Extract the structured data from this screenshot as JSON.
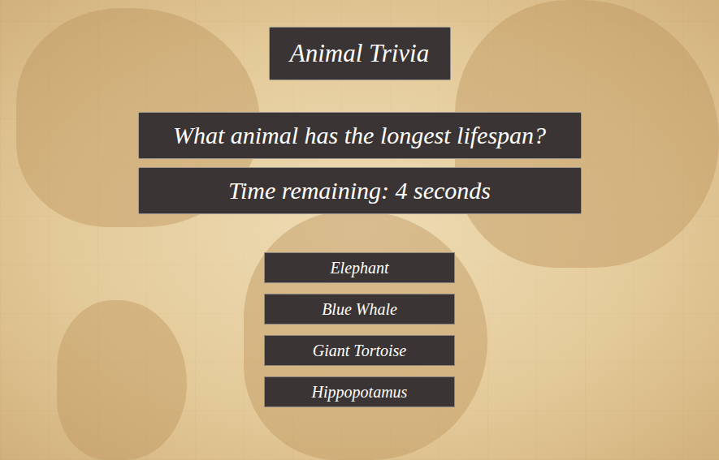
{
  "header": {
    "title": "Animal Trivia"
  },
  "question": {
    "text": "What animal has the longest lifespan?"
  },
  "timer": {
    "text": "Time remaining: 4 seconds"
  },
  "answers": [
    {
      "label": "Elephant"
    },
    {
      "label": "Blue Whale"
    },
    {
      "label": "Giant Tortoise"
    },
    {
      "label": "Hippopotamus"
    }
  ]
}
